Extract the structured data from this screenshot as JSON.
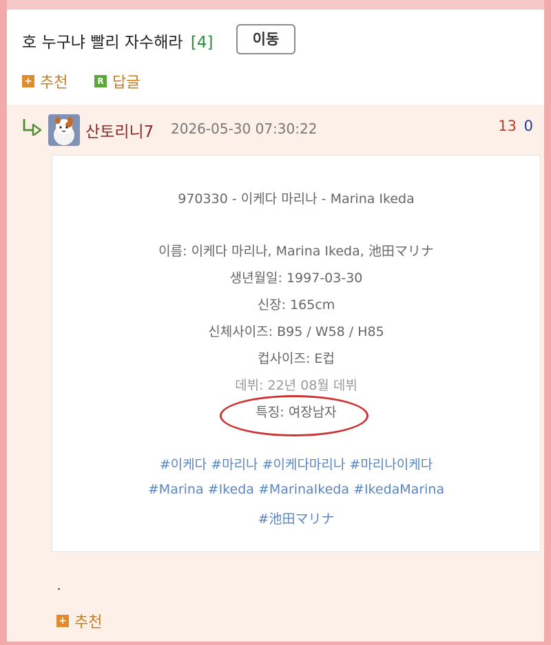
{
  "post": {
    "title": "호 누구냐 빨리 자수해라",
    "comment_count": "[4]",
    "move_label": "이동",
    "recommend_label": "추천",
    "reply_label": "답글"
  },
  "reply": {
    "nickname": "산토리니7",
    "date": "2026-05-30 07:30:22",
    "upvotes": "13",
    "downvotes": "0",
    "text": ".",
    "recommend_label": "추천"
  },
  "image_card": {
    "title": "970330 - 이케다 마리나 - Marina Ikeda",
    "lines": [
      "이름: 이케다 마리나, Marina Ikeda, 池田マリナ",
      "생년월일: 1997-03-30",
      "신장: 165cm",
      "신체사이즈: B95 / W58 / H85",
      "컵사이즈: E컵",
      "데뷔: 22년 08월 데뷔",
      "특징: 여장남자"
    ],
    "tags": [
      "#이케다 #마리나 #이케다마리나 #마리나이케다",
      "#Marina #Ikeda #MarinaIkeda #IkedaMarina",
      "#池田マリナ"
    ]
  },
  "colors": {
    "background_outer": "#f2aaaa",
    "reply_bg": "#fdf0e8",
    "accent_orange": "#c87e1e",
    "count_green": "#2e8b3a",
    "highlight_red": "#c33333",
    "tag_blue": "#5a86bd"
  },
  "icons": {
    "reply_arrow": "reply-arrow-icon",
    "recommend": "plus-square-icon",
    "reply": "r-square-icon"
  }
}
